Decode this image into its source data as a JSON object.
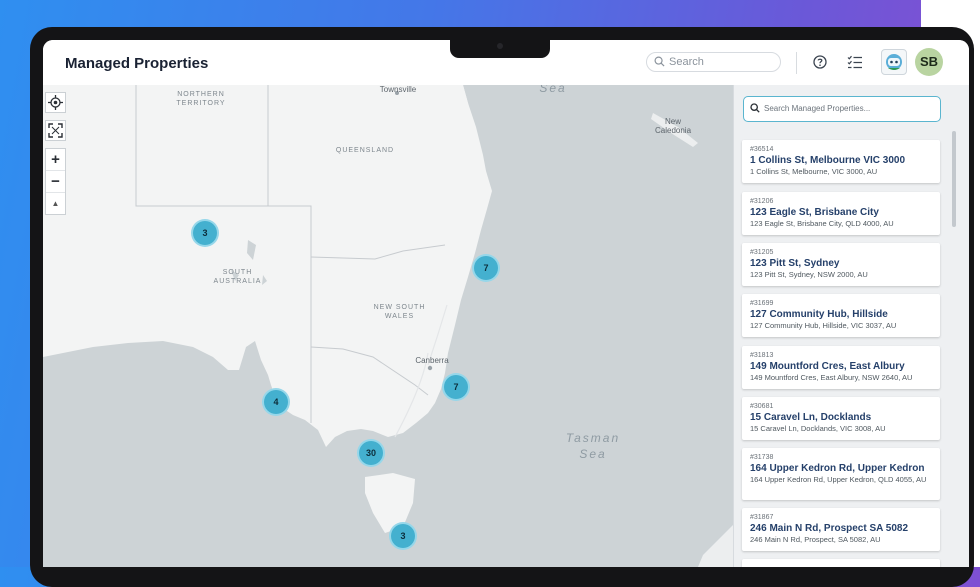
{
  "app": {
    "title": "Managed Properties"
  },
  "header": {
    "search_placeholder": "Search",
    "help_icon": "question-circle-icon",
    "checklist_icon": "checklist-icon",
    "user_initials": "SB",
    "colors": {
      "avatar_bg": "#b9d4a1",
      "accent": "#44b0cf"
    }
  },
  "map": {
    "region_labels": {
      "northern_territory": "NORTHERN TERRITORY",
      "queensland": "QUEENSLAND",
      "south_australia": "SOUTH AUSTRALIA",
      "new_south_wales": "NEW SOUTH WALES"
    },
    "city_labels": {
      "townsville": "Townsville",
      "canberra": "Canberra",
      "new_caledonia": "New Caledonia"
    },
    "sea_labels": {
      "coral_sea": "Sea",
      "tasman_sea": "Tasman Sea"
    },
    "clusters": [
      {
        "id": "nt",
        "count": "3"
      },
      {
        "id": "qld",
        "count": "7"
      },
      {
        "id": "nsw",
        "count": "7"
      },
      {
        "id": "sa",
        "count": "4"
      },
      {
        "id": "vic",
        "count": "30"
      },
      {
        "id": "tas",
        "count": "3"
      }
    ],
    "controls": {
      "locate": "+",
      "zoom_in": "+",
      "zoom_out": "−",
      "compass": "▲"
    }
  },
  "sidebar": {
    "search_placeholder": "Search Managed Properties...",
    "properties": [
      {
        "id": "#36514",
        "name": "1 Collins St, Melbourne VIC 3000",
        "address": "1 Collins St, Melbourne, VIC 3000, AU"
      },
      {
        "id": "#31206",
        "name": "123 Eagle St, Brisbane City",
        "address": "123 Eagle St, Brisbane City, QLD 4000, AU"
      },
      {
        "id": "#31205",
        "name": "123 Pitt St, Sydney",
        "address": "123 Pitt St, Sydney, NSW 2000, AU"
      },
      {
        "id": "#31699",
        "name": "127 Community Hub, Hillside",
        "address": "127 Community Hub, Hillside, VIC 3037, AU"
      },
      {
        "id": "#31813",
        "name": "149 Mountford Cres, East Albury",
        "address": "149 Mountford Cres, East Albury, NSW 2640, AU"
      },
      {
        "id": "#30681",
        "name": "15 Caravel Ln, Docklands",
        "address": "15 Caravel Ln, Docklands, VIC 3008, AU"
      },
      {
        "id": "#31738",
        "name": "164 Upper Kedron Rd, Upper Kedron",
        "address": "164 Upper Kedron Rd, Upper Kedron, QLD 4055, AU"
      },
      {
        "id": "#31867",
        "name": "246 Main N Rd, Prospect SA 5082",
        "address": "246 Main N Rd, Prospect, SA 5082, AU"
      }
    ]
  }
}
